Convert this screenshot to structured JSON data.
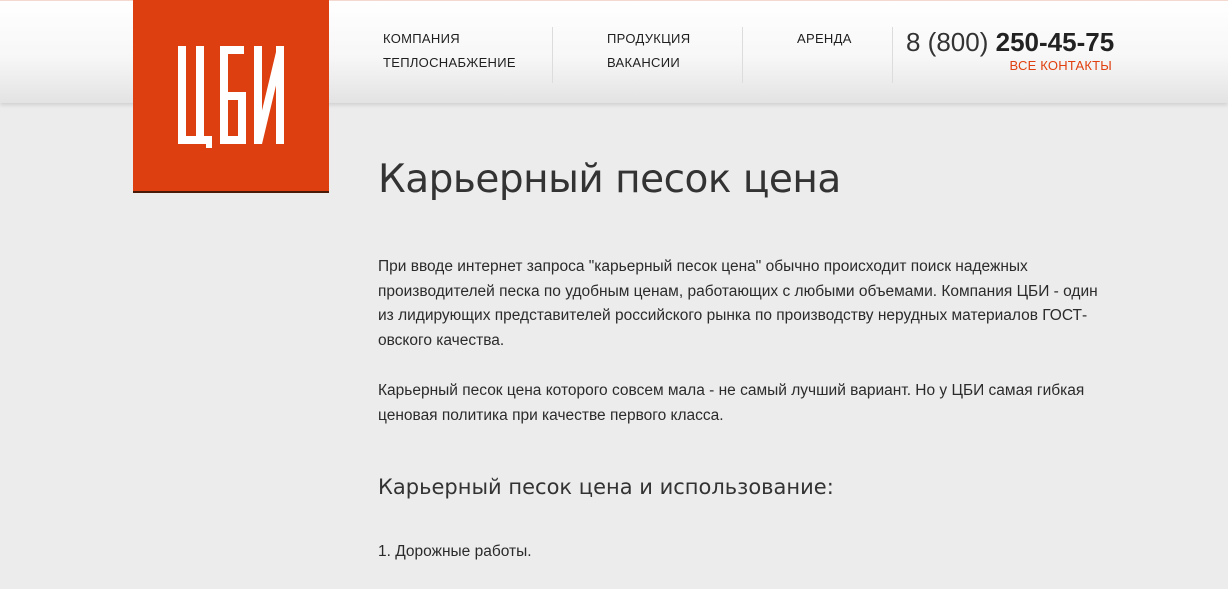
{
  "logo": {
    "text": "ЦБИ",
    "color": "#dd3f10"
  },
  "nav": {
    "col1": [
      "КОМПАНИЯ",
      "ТЕПЛОСНАБЖЕНИЕ"
    ],
    "col2": [
      "ПРОДУКЦИЯ",
      "ВАКАНСИИ"
    ],
    "col3": [
      "АРЕНДА"
    ]
  },
  "contact": {
    "phone_prefix": "8 (800)",
    "phone_number": "250-45-75",
    "all_contacts_label": "ВСЕ КОНТАКТЫ",
    "accent_color": "#e0400f"
  },
  "content": {
    "title": "Карьерный песок цена",
    "paragraph1": "При вводе интернет запроса \"карьерный песок цена\" обычно происходит поиск надежных производителей песка по удобным ценам, работающих с любыми объемами. Компания ЦБИ - один из лидирующих представителей российского рынка по производству нерудных материалов ГОСТ-овского качества.",
    "paragraph2": "Карьерный песок цена которого совсем мала - не самый лучший вариант. Но у ЦБИ самая гибкая ценовая политика при качестве первого класса.",
    "subtitle": "Карьерный песок цена  и использование:",
    "list_item1": "1. Дорожные работы."
  }
}
